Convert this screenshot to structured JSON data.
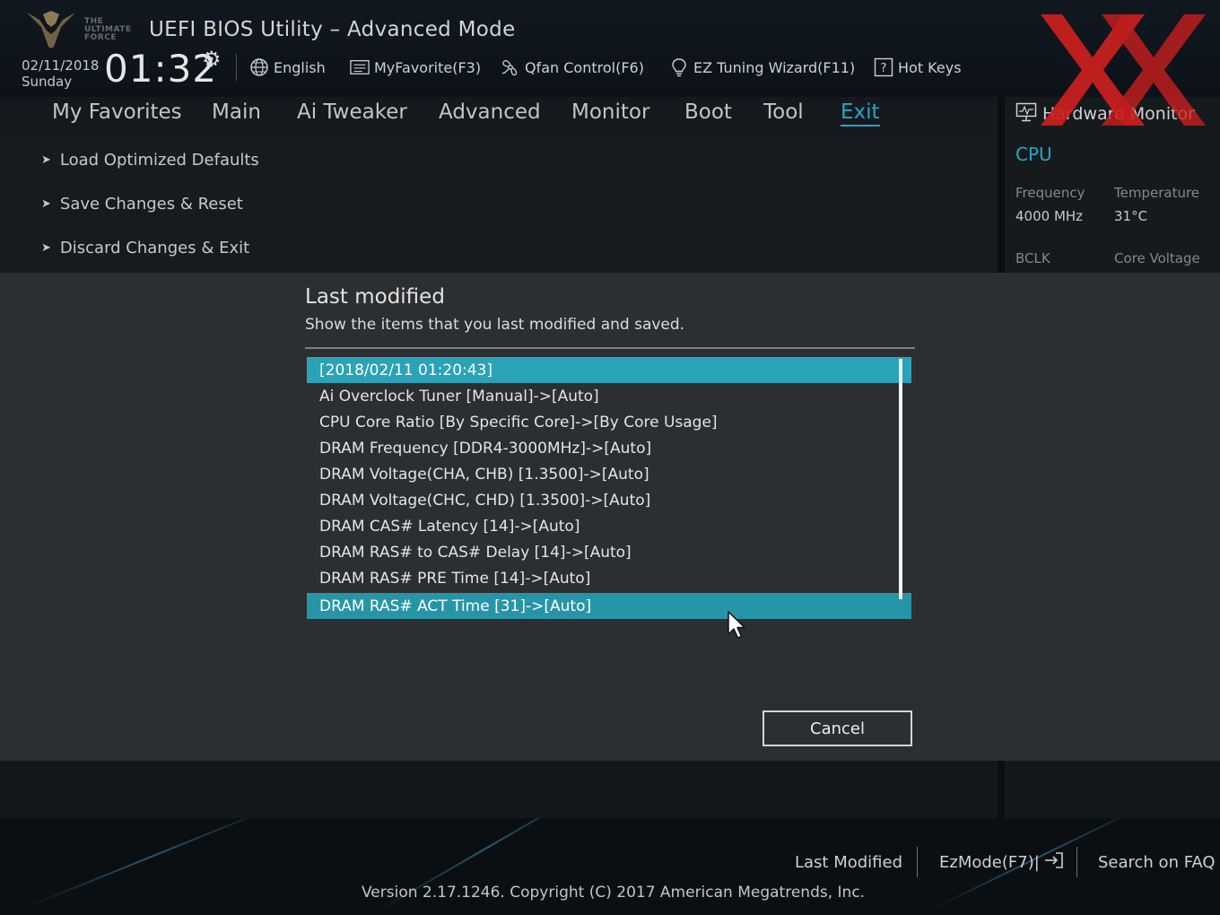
{
  "header": {
    "title": "UEFI BIOS Utility – Advanced Mode",
    "logo_text": [
      "THE",
      "ULTIMATE",
      "FORCE"
    ],
    "date": "02/11/2018",
    "day": "Sunday",
    "time": "01:32",
    "settings_icon": "gear-icon",
    "toolbar": [
      {
        "label": "English",
        "icon": "globe-icon"
      },
      {
        "label": "MyFavorite(F3)",
        "icon": "favorite-list-icon"
      },
      {
        "label": "Qfan Control(F6)",
        "icon": "fan-icon"
      },
      {
        "label": "EZ Tuning Wizard(F11)",
        "icon": "lightbulb-icon"
      },
      {
        "label": "Hot Keys",
        "icon": "question-icon"
      }
    ]
  },
  "nav": {
    "tabs": [
      "My Favorites",
      "Main",
      "Ai Tweaker",
      "Advanced",
      "Monitor",
      "Boot",
      "Tool",
      "Exit"
    ],
    "active": "Exit"
  },
  "menu": {
    "items": [
      "Load Optimized Defaults",
      "Save Changes & Reset",
      "Discard Changes & Exit"
    ]
  },
  "hardware_monitor": {
    "title": "Hardware Monitor",
    "icon": "monitor-icon",
    "section": "CPU",
    "frequency_label": "Frequency",
    "frequency_value": "4000 MHz",
    "temperature_label": "Temperature",
    "temperature_value": "31°C",
    "bclk_label": "BCLK",
    "core_voltage_label": "Core Voltage"
  },
  "dialog": {
    "title": "Last modified",
    "subtitle": "Show the items that you last modified and saved.",
    "entries": [
      "[2018/02/11 01:20:43]",
      "Ai Overclock Tuner [Manual]->[Auto]",
      "CPU Core Ratio [By Specific Core]->[By Core Usage]",
      "DRAM Frequency [DDR4-3000MHz]->[Auto]",
      "DRAM Voltage(CHA, CHB) [1.3500]->[Auto]",
      "DRAM Voltage(CHC, CHD) [1.3500]->[Auto]",
      "DRAM CAS# Latency [14]->[Auto]",
      "DRAM RAS# to CAS# Delay [14]->[Auto]",
      "DRAM RAS# PRE Time [14]->[Auto]",
      "DRAM RAS# ACT Time [31]->[Auto]"
    ],
    "selected_entry": "DRAM RAS# ACT Time [31]->[Auto]",
    "cancel_label": "Cancel"
  },
  "footer": {
    "last_modified": "Last Modified",
    "ezmode": "EzMode(F7)|",
    "ezmode_icon": "exit-arrow-icon",
    "search_faq": "Search on FAQ",
    "version": "Version 2.17.1246. Copyright (C) 2017 American Megatrends, Inc."
  },
  "colors": {
    "accent": "#1fa8c4",
    "list_highlight": "#2aa3b8",
    "dialog_bg": "#2c2f32",
    "watermark": "#cc1f1f"
  }
}
